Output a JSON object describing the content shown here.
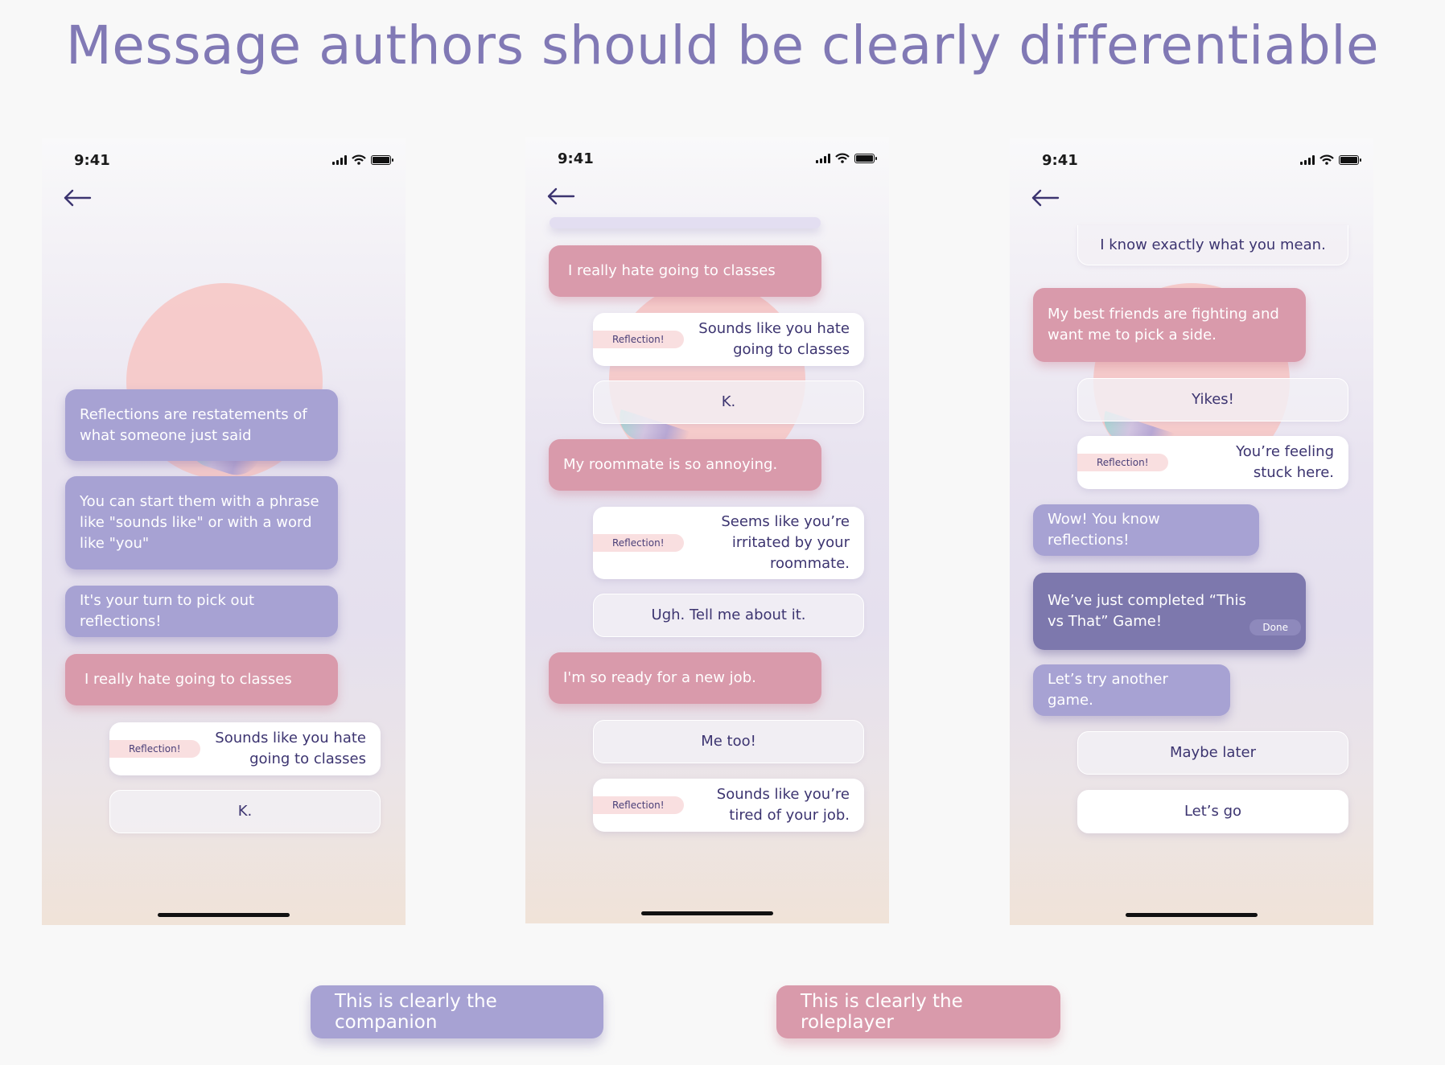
{
  "headline": "Message authors should be clearly differentiable",
  "status": {
    "time": "9:41",
    "signal_icon": "cellular-signal-icon",
    "wifi_icon": "wifi-icon",
    "battery_icon": "battery-icon"
  },
  "nav": {
    "back_icon": "back-arrow-icon"
  },
  "badges": {
    "reflection": "Reflection!",
    "done": "Done"
  },
  "colors": {
    "companion": "#a7a2d3",
    "companion_dark": "#7d78ad",
    "roleplayer": "#d99aab",
    "reflection_badge": "#f9dfe0",
    "headline": "#8179b5",
    "text_dark": "#3c3470"
  },
  "phone1": {
    "companion_1": "Reflections are restatements of what someone just said",
    "companion_2": "You can start them with a phrase like \"sounds like\" or with a word like \"you\"",
    "companion_3": "It's your turn to pick out reflections!",
    "roleplayer_1": "I really hate going to classes",
    "reflection_1": "Sounds like you hate going to classes",
    "option_1": "K."
  },
  "phone2": {
    "roleplayer_1": "I really hate going to classes",
    "reflection_1": "Sounds like you hate going to classes",
    "option_1": "K.",
    "roleplayer_2": "My roommate is so annoying.",
    "reflection_2": "Seems like you’re irritated by your roommate.",
    "option_2": "Ugh. Tell me about it.",
    "roleplayer_3": "I'm so ready for a new job.",
    "option_3": "Me too!",
    "reflection_3": "Sounds like you’re tired of your job."
  },
  "phone3": {
    "option_top": "I know exactly what you mean.",
    "roleplayer_1": "My best friends are fighting and want me to pick a side.",
    "option_1": "Yikes!",
    "reflection_1": "You’re feeling stuck here.",
    "companion_1": "Wow! You know reflections!",
    "companion_2": "We’ve just completed “This vs That” Game!",
    "companion_3": "Let’s try another game.",
    "option_2": "Maybe later",
    "option_3": "Let’s go"
  },
  "legend": {
    "companion": "This is clearly the companion",
    "roleplayer": "This is clearly the roleplayer"
  }
}
